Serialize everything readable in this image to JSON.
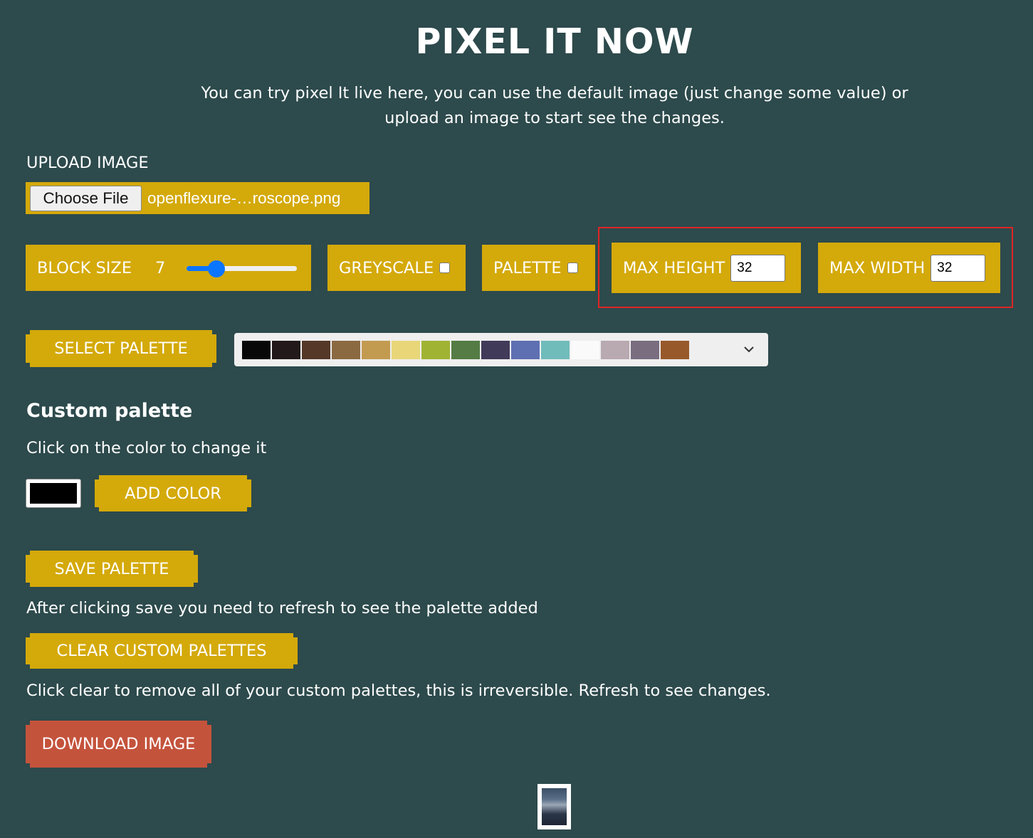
{
  "page": {
    "title": "PIXEL IT NOW",
    "intro": "You can try pixel It live here, you can use the default image (just change some value) or upload an image to start see the changes."
  },
  "upload": {
    "label": "UPLOAD IMAGE",
    "button_label": "Choose File",
    "file_name": "openflexure-…roscope.png"
  },
  "controls": {
    "block_size_label": "BLOCK SIZE",
    "block_size_value": "7",
    "block_size_fraction": 0.27,
    "greyscale_label": "GREYSCALE",
    "greyscale_checked": false,
    "palette_label": "PALETTE",
    "palette_checked": false,
    "max_height_label": "MAX HEIGHT",
    "max_height_value": "32",
    "max_width_label": "MAX WIDTH",
    "max_width_value": "32"
  },
  "palette": {
    "select_label": "SELECT PALETTE",
    "colors": [
      "#080808",
      "#221a1a",
      "#553828",
      "#8b6a42",
      "#c39b50",
      "#e8d679",
      "#a1b333",
      "#547c44",
      "#413a59",
      "#5e70b2",
      "#70bcbb",
      "#fafafa",
      "#b9a9b1",
      "#7a6d80",
      "#98592a"
    ]
  },
  "custom_palette": {
    "heading": "Custom palette",
    "instruction": "Click on the color to change it",
    "current_color": "#000000",
    "add_color_label": "ADD COLOR",
    "save_label": "SAVE PALETTE",
    "save_note": "After clicking save you need to refresh to see the palette added",
    "clear_label": "CLEAR CUSTOM PALETTES",
    "clear_note": "Click clear to remove all of your custom palettes, this is irreversible. Refresh to see changes."
  },
  "download": {
    "label": "DOWNLOAD IMAGE"
  },
  "colors": {
    "background": "#2d4a4c",
    "accent": "#d4a90a",
    "download": "#c4533c",
    "highlight": "#e02424",
    "slider": "#0a75ff"
  }
}
